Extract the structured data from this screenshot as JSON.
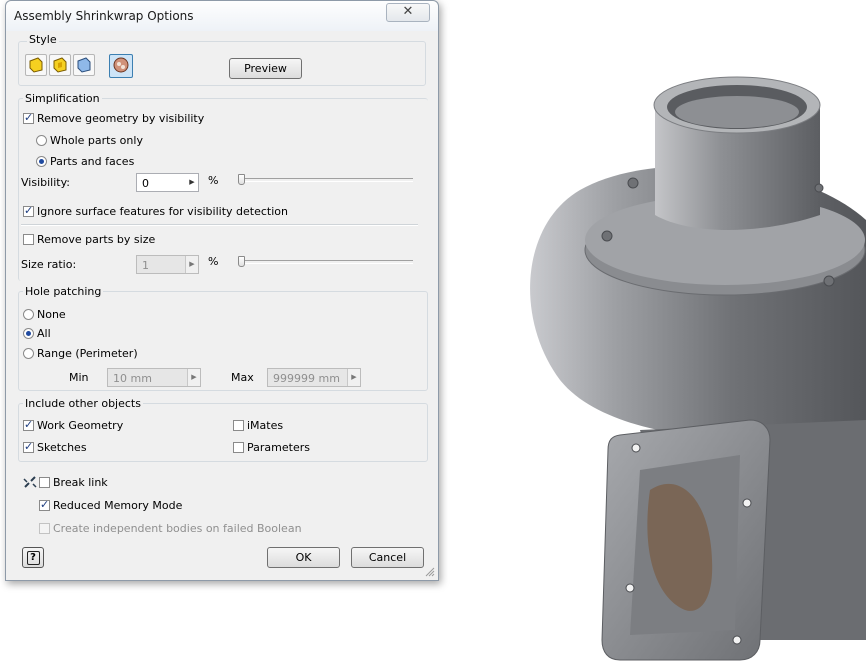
{
  "dialog": {
    "title": "Assembly Shrinkwrap Options",
    "close_label": "✕"
  },
  "style_group": {
    "label": "Style",
    "preview_label": "Preview"
  },
  "simplification": {
    "label": "Simplification",
    "remove_geometry_label": "Remove geometry by visibility",
    "whole_parts_label": "Whole parts only",
    "parts_faces_label": "Parts and faces",
    "visibility_label": "Visibility:",
    "visibility_value": "0",
    "visibility_unit": "%",
    "ignore_surface_label": "Ignore surface features for visibility detection",
    "remove_parts_size_label": "Remove parts by size",
    "size_ratio_label": "Size ratio:",
    "size_ratio_value": "1",
    "size_ratio_unit": "%"
  },
  "hole_patching": {
    "label": "Hole patching",
    "none_label": "None",
    "all_label": "All",
    "range_label": "Range (Perimeter)",
    "min_label": "Min",
    "min_value": "10 mm",
    "max_label": "Max",
    "max_value": "999999 mm"
  },
  "include_objects": {
    "label": "Include other objects",
    "work_geometry_label": "Work Geometry",
    "sketches_label": "Sketches",
    "imates_label": "iMates",
    "parameters_label": "Parameters"
  },
  "bottom": {
    "break_link_label": "Break link",
    "reduced_memory_label": "Reduced Memory Mode",
    "independent_bodies_label": "Create independent bodies on failed Boolean",
    "help_label": "?",
    "ok_label": "OK",
    "cancel_label": "Cancel"
  },
  "model": {
    "body_color": "#8d8f94"
  }
}
